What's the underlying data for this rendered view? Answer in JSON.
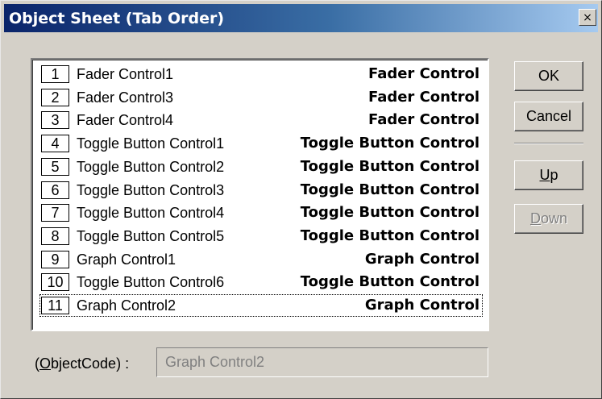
{
  "window": {
    "title": "Object Sheet (Tab Order)",
    "close_glyph": "×"
  },
  "list": {
    "items": [
      {
        "num": "1",
        "name": "Fader Control1",
        "type": "Fader Control"
      },
      {
        "num": "2",
        "name": "Fader Control3",
        "type": "Fader Control"
      },
      {
        "num": "3",
        "name": "Fader Control4",
        "type": "Fader Control"
      },
      {
        "num": "4",
        "name": "Toggle Button Control1",
        "type": "Toggle Button Control"
      },
      {
        "num": "5",
        "name": "Toggle Button Control2",
        "type": "Toggle Button Control"
      },
      {
        "num": "6",
        "name": "Toggle Button Control3",
        "type": "Toggle Button Control"
      },
      {
        "num": "7",
        "name": "Toggle Button Control4",
        "type": "Toggle Button Control"
      },
      {
        "num": "8",
        "name": "Toggle Button Control5",
        "type": "Toggle Button Control"
      },
      {
        "num": "9",
        "name": "Graph Control1",
        "type": "Graph Control"
      },
      {
        "num": "10",
        "name": "Toggle Button Control6",
        "type": "Toggle Button Control"
      },
      {
        "num": "11",
        "name": "Graph Control2",
        "type": "Graph Control"
      }
    ],
    "selected_num": "11"
  },
  "buttons": {
    "ok": "OK",
    "cancel": "Cancel",
    "up_mnemonic": "U",
    "up_rest": "p",
    "down_mnemonic": "D",
    "down_rest": "own"
  },
  "object_code": {
    "label_open": "(",
    "label_mnemonic": "O",
    "label_rest": "bjectCode) :",
    "value": "Graph Control2"
  }
}
